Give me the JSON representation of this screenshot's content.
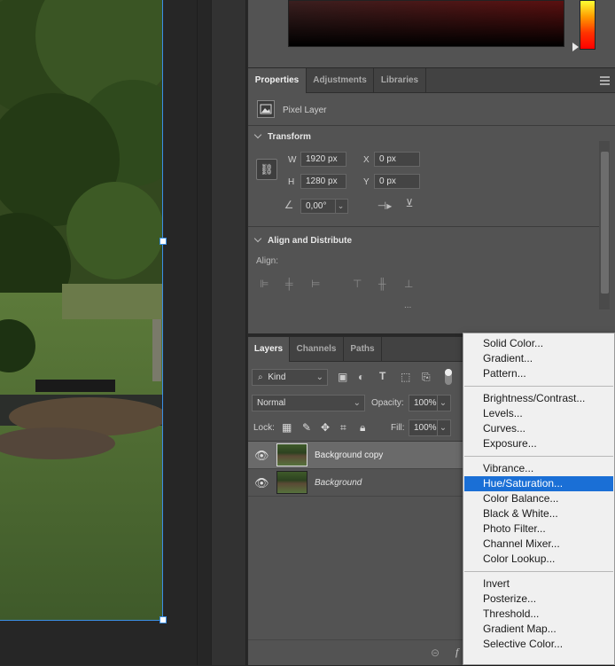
{
  "properties": {
    "tabs": [
      "Properties",
      "Adjustments",
      "Libraries"
    ],
    "layer_type": "Pixel Layer",
    "transform": {
      "title": "Transform",
      "w_label": "W",
      "w_value": "1920 px",
      "h_label": "H",
      "h_value": "1280 px",
      "x_label": "X",
      "x_value": "0 px",
      "y_label": "Y",
      "y_value": "0 px",
      "angle_value": "0,00°"
    },
    "align": {
      "title": "Align and Distribute",
      "align_label": "Align:",
      "more": "..."
    }
  },
  "layers": {
    "tabs": [
      "Layers",
      "Channels",
      "Paths"
    ],
    "filter_kind": "Kind",
    "blend_mode": "Normal",
    "opacity_label": "Opacity:",
    "opacity_value": "100%",
    "lock_label": "Lock:",
    "fill_label": "Fill:",
    "fill_value": "100%",
    "items": [
      {
        "name": "Background copy",
        "selected": true
      },
      {
        "name": "Background",
        "selected": false
      }
    ]
  },
  "menu": {
    "groups": [
      [
        "Solid Color...",
        "Gradient...",
        "Pattern..."
      ],
      [
        "Brightness/Contrast...",
        "Levels...",
        "Curves...",
        "Exposure..."
      ],
      [
        "Vibrance...",
        "Hue/Saturation...",
        "Color Balance...",
        "Black & White...",
        "Photo Filter...",
        "Channel Mixer...",
        "Color Lookup..."
      ],
      [
        "Invert",
        "Posterize...",
        "Threshold...",
        "Gradient Map...",
        "Selective Color..."
      ]
    ],
    "highlighted": "Hue/Saturation..."
  },
  "colors": {
    "selection": "#1a6fd6",
    "panel": "#535353",
    "tabbar": "#424242"
  }
}
